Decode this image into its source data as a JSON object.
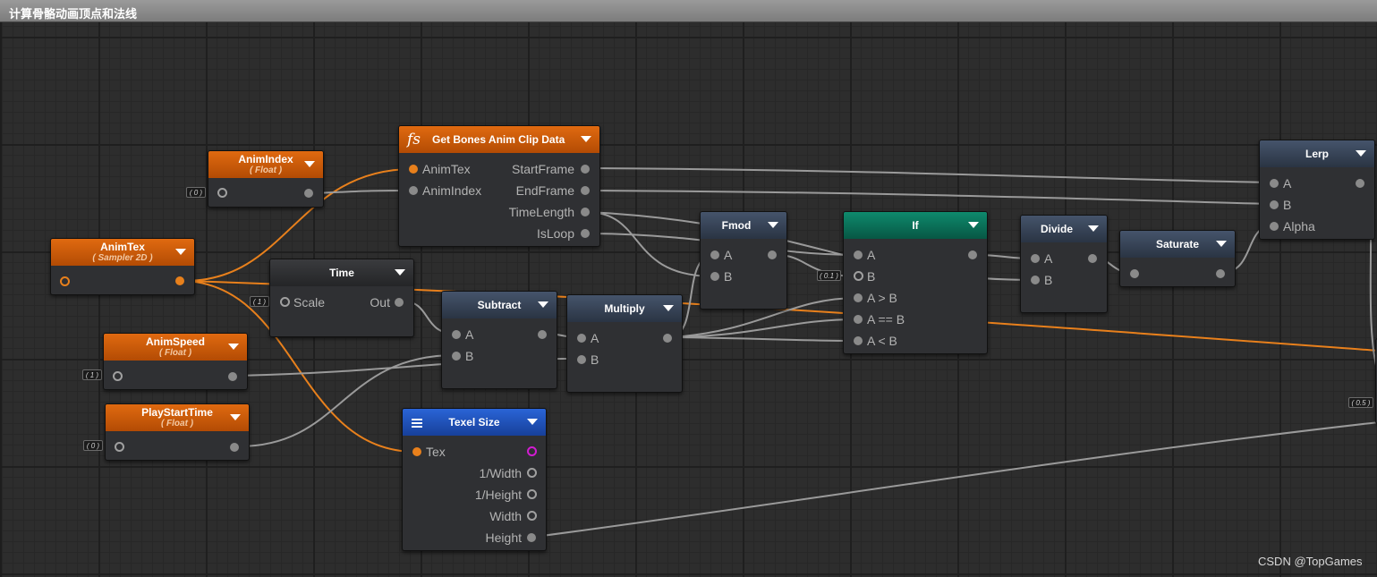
{
  "window": {
    "title": "计算骨骼动画顶点和法线"
  },
  "nodes": {
    "animIndex": {
      "title": "AnimIndex",
      "subtitle": "( Float )",
      "default": "( 0 )"
    },
    "animTex": {
      "title": "AnimTex",
      "subtitle": "( Sampler 2D )"
    },
    "animSpeed": {
      "title": "AnimSpeed",
      "subtitle": "( Float )",
      "default": "( 1 )"
    },
    "playStartTime": {
      "title": "PlayStartTime",
      "subtitle": "( Float )",
      "default": "( 0 )"
    },
    "getBones": {
      "title": "Get Bones Anim Clip Data",
      "inputs": [
        "AnimTex",
        "AnimIndex"
      ],
      "outputs": [
        "StartFrame",
        "EndFrame",
        "TimeLength",
        "IsLoop"
      ]
    },
    "time": {
      "title": "Time",
      "input": "Scale",
      "output": "Out",
      "default": "( 1 )"
    },
    "subtract": {
      "title": "Subtract",
      "inputs": [
        "A",
        "B"
      ]
    },
    "multiply": {
      "title": "Multiply",
      "inputs": [
        "A",
        "B"
      ]
    },
    "fmod": {
      "title": "Fmod",
      "inputs": [
        "A",
        "B"
      ]
    },
    "if": {
      "title": "If",
      "inputs": [
        "A",
        "B",
        "A > B",
        "A == B",
        "A < B"
      ],
      "default_b": "( 0.1 )"
    },
    "divide": {
      "title": "Divide",
      "inputs": [
        "A",
        "B"
      ]
    },
    "saturate": {
      "title": "Saturate"
    },
    "lerp": {
      "title": "Lerp",
      "inputs": [
        "A",
        "B",
        "Alpha"
      ]
    },
    "texelSize": {
      "title": "Texel Size",
      "input": "Tex",
      "outputs": [
        "1/Width",
        "1/Height",
        "Width",
        "Height"
      ]
    },
    "partial": {
      "default": "( 0.5 )"
    }
  },
  "colors": {
    "header_property": "#d4600c",
    "header_function": "#d4600c",
    "header_operator": "#3a4658",
    "header_if": "#0b7a60",
    "header_texel": "#2256c0",
    "wire_orange": "#e8801c",
    "wire_gray": "#9a9a9a"
  },
  "icons": {
    "function": "function-fs-icon",
    "texel": "hamburger-menu-icon",
    "dropdown": "triangle-down-icon"
  },
  "watermark": "CSDN @TopGames"
}
